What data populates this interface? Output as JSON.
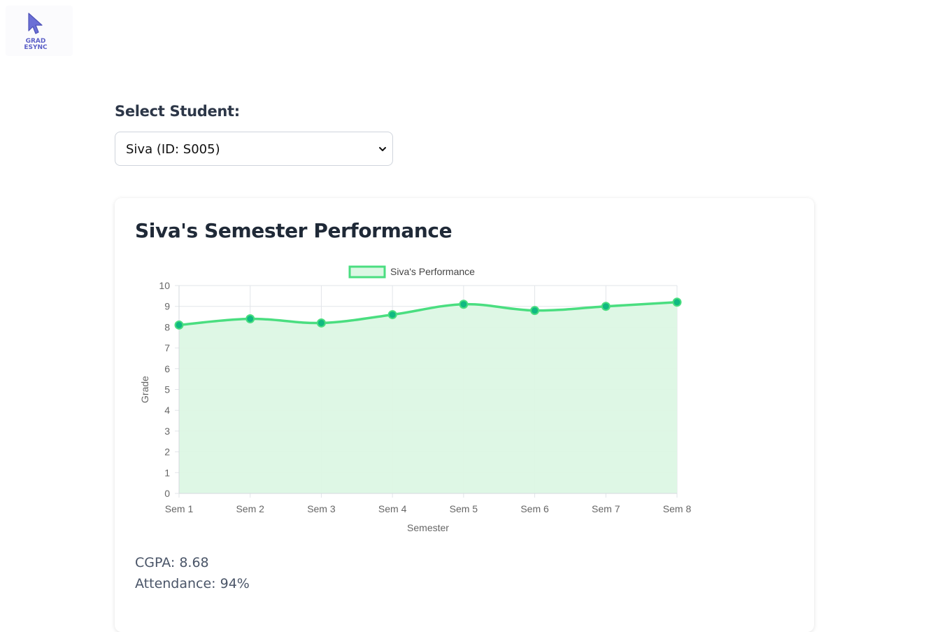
{
  "logo": {
    "line1": "GRAD",
    "line2": "ESYNC",
    "icon": "cursor-arrow-icon"
  },
  "selector": {
    "label": "Select Student:",
    "selected": "Siva (ID: S005)",
    "icon": "chevron-down-icon"
  },
  "card": {
    "title": "Siva's Semester Performance",
    "cgpa": "CGPA: 8.68",
    "attendance": "Attendance: 94%"
  },
  "chart_data": {
    "type": "area",
    "categories": [
      "Sem 1",
      "Sem 2",
      "Sem 3",
      "Sem 4",
      "Sem 5",
      "Sem 6",
      "Sem 7",
      "Sem 8"
    ],
    "series": [
      {
        "name": "Siva's Performance",
        "values": [
          8.1,
          8.4,
          8.2,
          8.6,
          9.1,
          8.8,
          9.0,
          9.2
        ]
      }
    ],
    "xlabel": "Semester",
    "ylabel": "Grade",
    "ylim": [
      0,
      10
    ],
    "yticks": [
      0,
      1,
      2,
      3,
      4,
      5,
      6,
      7,
      8,
      9,
      10
    ],
    "grid": true,
    "legend": "top",
    "colors": {
      "line": "#4ade80",
      "fill": "#dcf7e4",
      "point": "#10b981",
      "grid": "#e2e5e9",
      "axis_text": "#666666"
    }
  }
}
